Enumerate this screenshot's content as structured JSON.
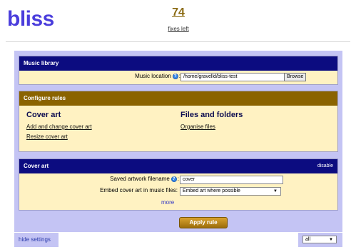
{
  "header": {
    "logo": "bliss",
    "fixes_count": "74",
    "fixes_label": "fixes left"
  },
  "music_library": {
    "title": "Music library",
    "location_label": "Music location",
    "help_glyph": "?",
    "location_value": "/home/gravelld/bliss-test",
    "browse_label": "Browse"
  },
  "configure_rules": {
    "title": "Configure rules",
    "columns": [
      {
        "heading": "Cover art",
        "links": [
          "Add and change cover art",
          "Resize cover art"
        ]
      },
      {
        "heading": "Files and folders",
        "links": [
          "Organise files"
        ]
      }
    ]
  },
  "cover_art": {
    "title": "Cover art",
    "disable_label": "disable",
    "filename_label": "Saved artwork filename",
    "filename_value": "cover",
    "embed_label": "Embed cover art in music files:",
    "embed_value": "Embed art where possible",
    "more_label": "more"
  },
  "apply_label": "Apply rule",
  "footer": {
    "hide_settings_label": "hide settings",
    "filter_value": "all"
  },
  "colors": {
    "logo": "#4a3ddc",
    "panel_blue": "#0c0c80",
    "panel_brown": "#8a6300",
    "panel_body": "#fff2c2",
    "background_lavender": "#c4c4f4",
    "apply_gold": "#d9a22e"
  },
  "icons": {
    "help": "help-icon",
    "dropdown": "chevron-down-icon"
  }
}
